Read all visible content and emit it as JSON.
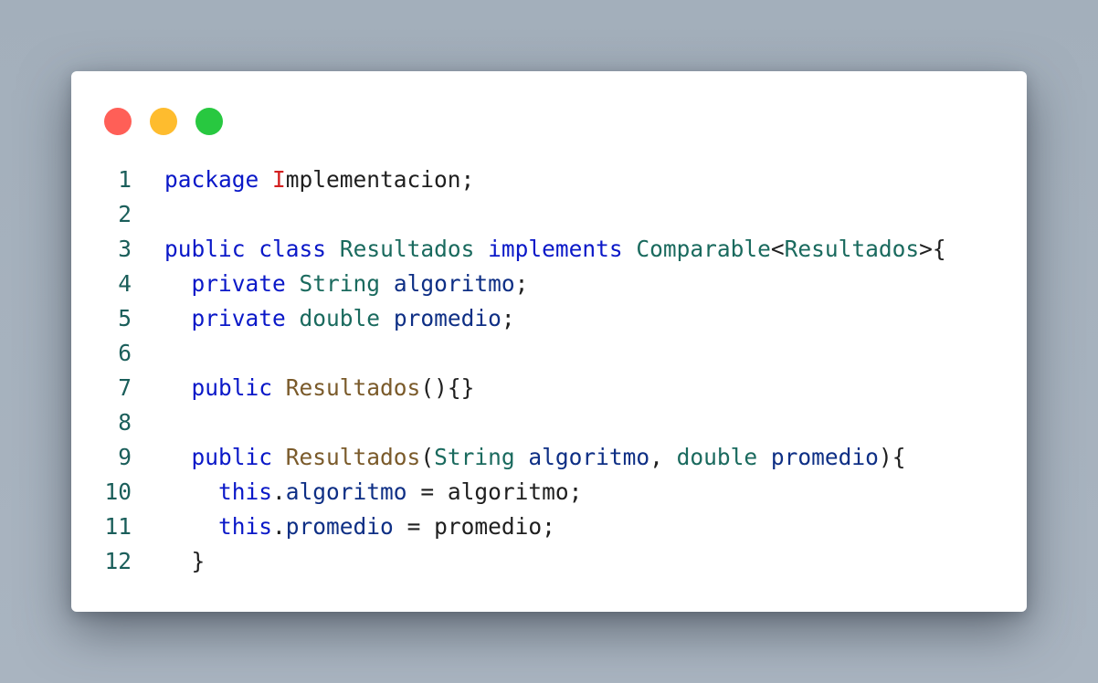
{
  "window": {
    "controls": [
      {
        "name": "close",
        "color": "#ff5f57"
      },
      {
        "name": "minimize",
        "color": "#febc2e"
      },
      {
        "name": "maximize",
        "color": "#28c840"
      }
    ]
  },
  "code": {
    "language": "java",
    "lines": [
      {
        "n": "1",
        "tokens": [
          {
            "t": "package",
            "c": "kw"
          },
          {
            "t": " "
          },
          {
            "t": "I",
            "c": "err"
          },
          {
            "t": "mplementacion;"
          }
        ]
      },
      {
        "n": "2",
        "tokens": []
      },
      {
        "n": "3",
        "tokens": [
          {
            "t": "public",
            "c": "kw"
          },
          {
            "t": " "
          },
          {
            "t": "class",
            "c": "kw"
          },
          {
            "t": " "
          },
          {
            "t": "Resultados",
            "c": "ty"
          },
          {
            "t": " "
          },
          {
            "t": "implements",
            "c": "kw"
          },
          {
            "t": " "
          },
          {
            "t": "Comparable",
            "c": "ty"
          },
          {
            "t": "<"
          },
          {
            "t": "Resultados",
            "c": "ty"
          },
          {
            "t": ">{"
          }
        ]
      },
      {
        "n": "4",
        "tokens": [
          {
            "t": "  "
          },
          {
            "t": "private",
            "c": "kw"
          },
          {
            "t": " "
          },
          {
            "t": "String",
            "c": "ty"
          },
          {
            "t": " "
          },
          {
            "t": "algoritmo",
            "c": "var"
          },
          {
            "t": ";"
          }
        ]
      },
      {
        "n": "5",
        "tokens": [
          {
            "t": "  "
          },
          {
            "t": "private",
            "c": "kw"
          },
          {
            "t": " "
          },
          {
            "t": "double",
            "c": "ty"
          },
          {
            "t": " "
          },
          {
            "t": "promedio",
            "c": "var"
          },
          {
            "t": ";"
          }
        ]
      },
      {
        "n": "6",
        "tokens": []
      },
      {
        "n": "7",
        "tokens": [
          {
            "t": "  "
          },
          {
            "t": "public",
            "c": "kw"
          },
          {
            "t": " "
          },
          {
            "t": "Resultados",
            "c": "fn"
          },
          {
            "t": "(){}"
          }
        ]
      },
      {
        "n": "8",
        "tokens": []
      },
      {
        "n": "9",
        "tokens": [
          {
            "t": "  "
          },
          {
            "t": "public",
            "c": "kw"
          },
          {
            "t": " "
          },
          {
            "t": "Resultados",
            "c": "fn"
          },
          {
            "t": "("
          },
          {
            "t": "String",
            "c": "ty"
          },
          {
            "t": " "
          },
          {
            "t": "algoritmo",
            "c": "var"
          },
          {
            "t": ", "
          },
          {
            "t": "double",
            "c": "ty"
          },
          {
            "t": " "
          },
          {
            "t": "promedio",
            "c": "var"
          },
          {
            "t": "){"
          }
        ]
      },
      {
        "n": "10",
        "tokens": [
          {
            "t": "    "
          },
          {
            "t": "this",
            "c": "kw"
          },
          {
            "t": "."
          },
          {
            "t": "algoritmo",
            "c": "var"
          },
          {
            "t": " = algoritmo;"
          }
        ]
      },
      {
        "n": "11",
        "tokens": [
          {
            "t": "    "
          },
          {
            "t": "this",
            "c": "kw"
          },
          {
            "t": "."
          },
          {
            "t": "promedio",
            "c": "var"
          },
          {
            "t": " = promedio;"
          }
        ]
      },
      {
        "n": "12",
        "tokens": [
          {
            "t": "  }"
          }
        ]
      }
    ]
  }
}
